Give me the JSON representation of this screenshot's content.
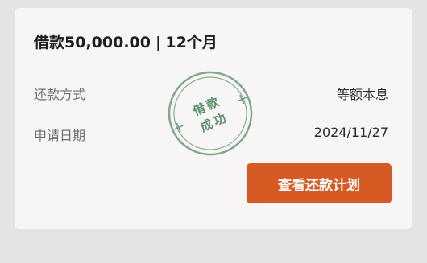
{
  "loan": {
    "amount_text": "借款50,000.00",
    "separator": "|",
    "term_text": "12个月"
  },
  "details": [
    {
      "label": "还款方式",
      "value": "等额本息"
    },
    {
      "label": "申请日期",
      "value": "2024/11/27"
    }
  ],
  "stamp": {
    "line1": "借款",
    "line2": "成功",
    "color": "#5b8e67"
  },
  "action": {
    "label": "查看还款计划",
    "color": "#d55a24"
  }
}
